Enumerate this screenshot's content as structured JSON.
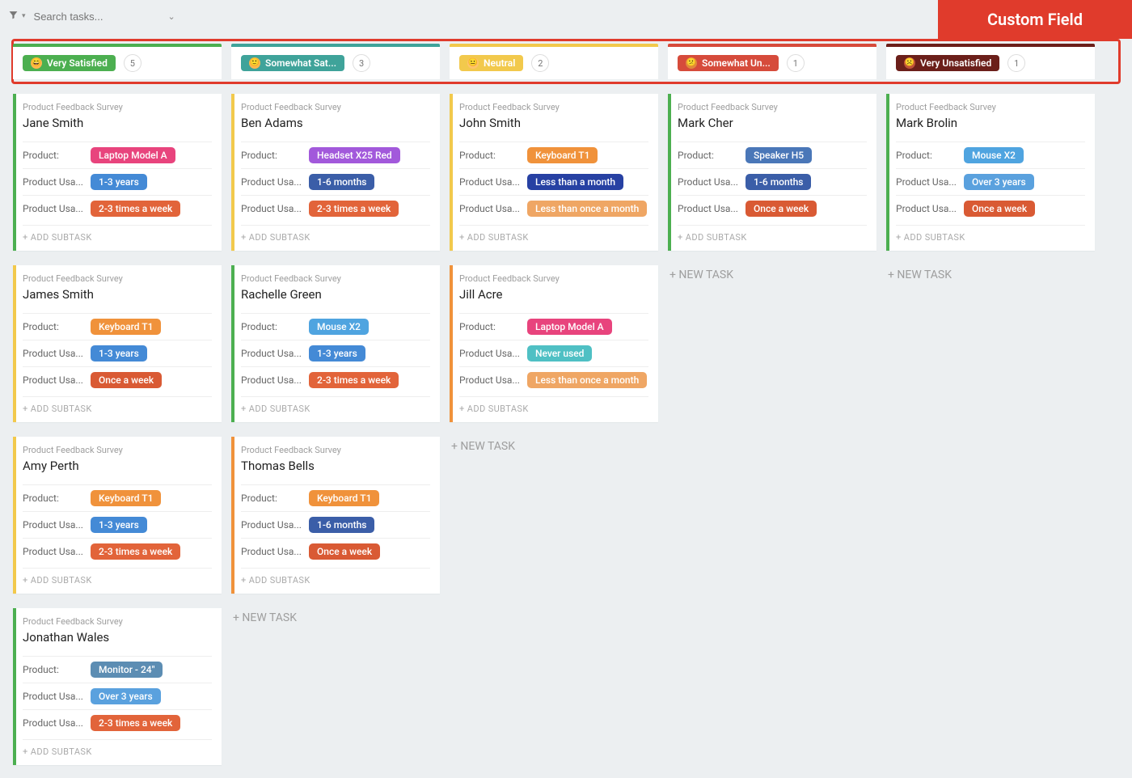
{
  "topbar": {
    "search_placeholder": "Search tasks...",
    "custom_field_label": "Custom Field"
  },
  "labels": {
    "folder": "Product Feedback Survey",
    "product": "Product:",
    "usage_length": "Product Usa...",
    "usage_freq": "Product Usa...",
    "add_subtask": "+ ADD SUBTASK",
    "new_task": "+ NEW TASK"
  },
  "tag_colors": {
    "Laptop Model A": "#e8447d",
    "Headset X25 Red": "#a259db",
    "Keyboard T1": "#f0923b",
    "Speaker H5": "#4a77b8",
    "Mouse X2": "#4fa4e0",
    "Monitor - 24\"": "#5c8db3",
    "1-3 years": "#448ad6",
    "1-6 months": "#3b5ea8",
    "Over 3 years": "#5aa1de",
    "Less than a month": "#2741a3",
    "Never used": "#4fc0c4",
    "2-3 times a week": "#e2643a",
    "Once a week": "#d95a34",
    "Less than once a month": "#efa664"
  },
  "accent_colors": {
    "green": "#4caf50",
    "yellow": "#f2c94c",
    "orange": "#f0923b"
  },
  "columns": [
    {
      "id": "very_satisfied",
      "accent": "#4caf50",
      "header_bg": "#4caf50",
      "emoji_bg": "#ffb74d",
      "emoji": "😄",
      "label": "Very Satisfied",
      "count": "5",
      "cards": [
        {
          "accent": "green",
          "title": "Jane Smith",
          "product": "Laptop Model A",
          "usage_length": "1-3 years",
          "usage_freq": "2-3 times a week"
        },
        {
          "accent": "yellow",
          "title": "James Smith",
          "product": "Keyboard T1",
          "usage_length": "1-3 years",
          "usage_freq": "Once a week"
        },
        {
          "accent": "yellow",
          "title": "Amy Perth",
          "product": "Keyboard T1",
          "usage_length": "1-3 years",
          "usage_freq": "2-3 times a week"
        },
        {
          "accent": "green",
          "title": "Jonathan Wales",
          "product": "Monitor - 24\"",
          "usage_length": "Over 3 years",
          "usage_freq": "2-3 times a week"
        }
      ],
      "show_new_task": false
    },
    {
      "id": "somewhat_satisfied",
      "accent": "#3fa39a",
      "header_bg": "#3fa39a",
      "emoji_bg": "#ffb74d",
      "emoji": "🙂",
      "label": "Somewhat Sat...",
      "count": "3",
      "cards": [
        {
          "accent": "yellow",
          "title": "Ben Adams",
          "product": "Headset X25 Red",
          "usage_length": "1-6 months",
          "usage_freq": "2-3 times a week"
        },
        {
          "accent": "green",
          "title": "Rachelle Green",
          "product": "Mouse X2",
          "usage_length": "1-3 years",
          "usage_freq": "2-3 times a week"
        },
        {
          "accent": "orange",
          "title": "Thomas Bells",
          "product": "Keyboard T1",
          "usage_length": "1-6 months",
          "usage_freq": "Once a week"
        }
      ],
      "show_new_task": true
    },
    {
      "id": "neutral",
      "accent": "#f2c94c",
      "header_bg": "#f2c94c",
      "emoji_bg": "#ffc46b",
      "emoji": "😐",
      "label": "Neutral",
      "count": "2",
      "cards": [
        {
          "accent": "yellow",
          "title": "John Smith",
          "product": "Keyboard T1",
          "usage_length": "Less than a month",
          "usage_freq": "Less than once a month"
        },
        {
          "accent": "orange",
          "title": "Jill Acre",
          "product": "Laptop Model A",
          "usage_length": "Never used",
          "usage_freq": "Less than once a month"
        }
      ],
      "show_new_task": true
    },
    {
      "id": "somewhat_unsatisfied",
      "accent": "#d64b3b",
      "header_bg": "#d64b3b",
      "emoji_bg": "#e08a3c",
      "emoji": "😕",
      "label": "Somewhat Un...",
      "count": "1",
      "cards": [
        {
          "accent": "green",
          "title": "Mark Cher",
          "product": "Speaker H5",
          "usage_length": "1-6 months",
          "usage_freq": "Once a week"
        }
      ],
      "show_new_task": true
    },
    {
      "id": "very_unsatisfied",
      "accent": "#6b1f1a",
      "header_bg": "#6b1f1a",
      "emoji_bg": "#c0533a",
      "emoji": "☹️",
      "label": "Very Unsatisfied",
      "count": "1",
      "cards": [
        {
          "accent": "green",
          "title": "Mark Brolin",
          "product": "Mouse X2",
          "usage_length": "Over 3 years",
          "usage_freq": "Once a week"
        }
      ],
      "show_new_task": true
    }
  ]
}
